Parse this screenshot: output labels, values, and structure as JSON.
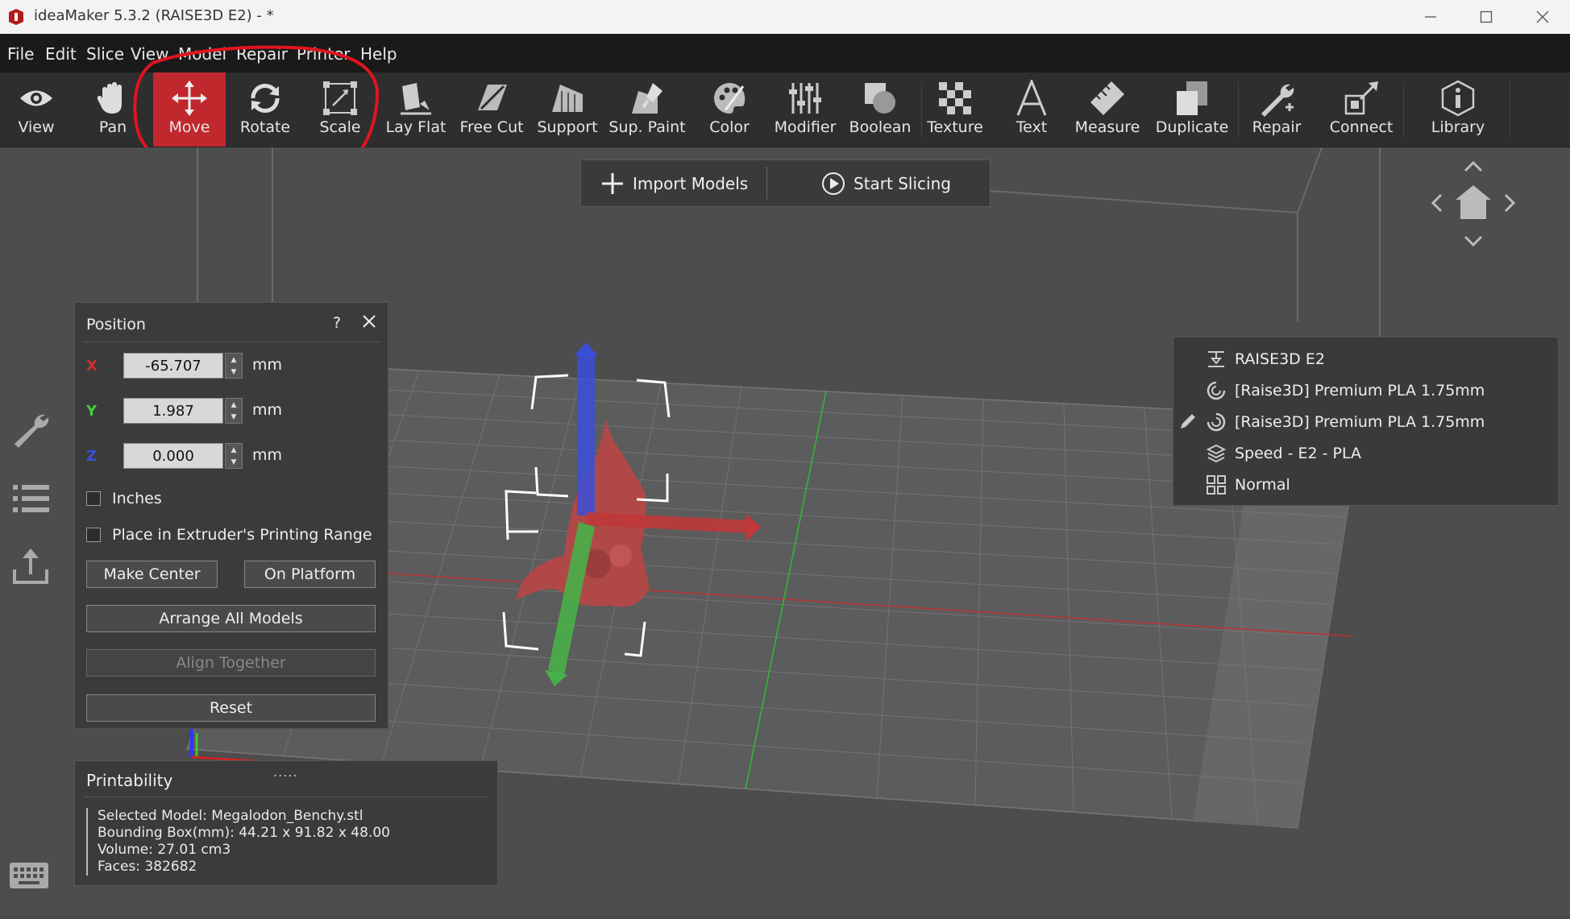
{
  "window": {
    "title": "ideaMaker 5.3.2 (RAISE3D E2) - *"
  },
  "menu": [
    "File",
    "Edit",
    "Slice",
    "View",
    "Model",
    "Repair",
    "Printer",
    "Help"
  ],
  "toolbar": [
    {
      "label": "View",
      "icon": "eye-icon"
    },
    {
      "label": "Pan",
      "icon": "hand-icon"
    },
    {
      "label": "Move",
      "icon": "move-arrows-icon",
      "active": true
    },
    {
      "label": "Rotate",
      "icon": "rotate-icon"
    },
    {
      "label": "Scale",
      "icon": "scale-icon"
    },
    {
      "label": "Lay Flat",
      "icon": "lay-flat-icon"
    },
    {
      "label": "Free Cut",
      "icon": "free-cut-icon"
    },
    {
      "label": "Support",
      "icon": "support-icon"
    },
    {
      "label": "Sup. Paint",
      "icon": "support-paint-icon"
    },
    {
      "label": "Color",
      "icon": "palette-icon"
    },
    {
      "label": "Modifier",
      "icon": "sliders-icon"
    },
    {
      "label": "Boolean",
      "icon": "boolean-icon"
    },
    {
      "label": "Texture",
      "icon": "checker-icon"
    },
    {
      "label": "Text",
      "icon": "text-icon"
    },
    {
      "label": "Measure",
      "icon": "ruler-icon"
    },
    {
      "label": "Duplicate",
      "icon": "duplicate-icon"
    },
    {
      "label": "Repair",
      "icon": "wrench-icon"
    },
    {
      "label": "Connect",
      "icon": "connect-icon"
    },
    {
      "label": "Library",
      "icon": "info-icon"
    }
  ],
  "actions": {
    "import": "Import Models",
    "slice": "Start Slicing"
  },
  "position_panel": {
    "title": "Position",
    "help": "?",
    "x_label": "X",
    "y_label": "Y",
    "z_label": "Z",
    "x_value": "-65.707",
    "y_value": "1.987",
    "z_value": "0.000",
    "unit": "mm",
    "inches_label": "Inches",
    "extruder_range_label": "Place in Extruder's Printing Range",
    "make_center": "Make Center",
    "on_platform": "On Platform",
    "arrange_all": "Arrange All Models",
    "align_together": "Align Together",
    "reset": "Reset"
  },
  "printability": {
    "title": "Printability",
    "drag_handle": ".....",
    "selected_model": "Selected Model: Megalodon_Benchy.stl",
    "bounding_box": "Bounding Box(mm): 44.21 x 91.82 x 48.00",
    "volume": "Volume: 27.01 cm3",
    "faces": "Faces: 382682"
  },
  "printer_info": {
    "printer": "RAISE3D E2",
    "filament_left": "[Raise3D] Premium PLA 1.75mm",
    "filament_right": "[Raise3D] Premium PLA 1.75mm",
    "profile": "Speed - E2 - PLA",
    "quality": "Normal"
  },
  "colors": {
    "active_tool": "#c0282d",
    "annotation_circle": "#e0141e",
    "axis_x": "#d03030",
    "axis_y": "#3ccf3c",
    "axis_z": "#3a4fd8",
    "model": "#b04848"
  }
}
